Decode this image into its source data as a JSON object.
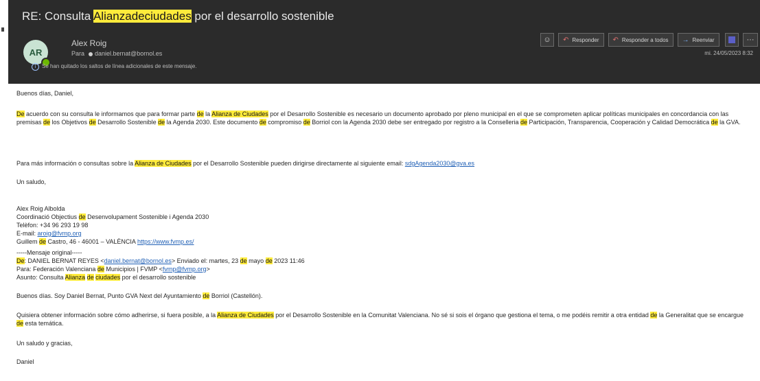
{
  "email": {
    "subject": {
      "prefix": "RE: Consulta ",
      "hl1": "Alianza",
      "hl2": "de",
      "hl3": "ciudades",
      "suffix": " por el desarrollo sostenible"
    },
    "sender": {
      "initials": "AR",
      "name": "Alex Roig",
      "to_label": "Para",
      "to_address": "daniel.bernat@bornol.es"
    },
    "info_banner": "Se han quitado los saltos de línea adicionales de este mensaje.",
    "date": "mi. 24/05/2023 8:32",
    "toolbar": {
      "reply": "Responder",
      "reply_all": "Responder a todos",
      "forward": "Reenviar",
      "more": "···"
    }
  },
  "body": {
    "greeting": "Buenos días, Daniel,",
    "p1": {
      "s1": "De",
      "t1": " acuerdo con su consulta le informamos que para formar parte ",
      "s2": "de",
      "t2": " la ",
      "s3": "Alianza de Ciudades",
      "t3": " por el Desarrollo Sostenible es necesario un documento aprobado por pleno municipal en el que se comprometen aplicar políticas municipales en concordancia con las premisas ",
      "s4": "de",
      "t4": " los Objetivos ",
      "s5": "de",
      "t5": " Desarrollo Sostenible ",
      "s6": "de",
      "t6": " la Agenda 2030. Este documento ",
      "s7": "de",
      "t7": " compromiso ",
      "s8": "de",
      "t8": " Borriol con la Agenda 2030 debe ser entregado por registro a la Conselleria ",
      "s9": "de",
      "t9": " Participación, Transparencia, Cooperación y Calidad Democrática ",
      "s10": "de",
      "t10": " la GVA."
    },
    "p2": {
      "t1": "Para más información o consultas sobre la ",
      "s1": "Alianza de Ciudades",
      "t2": " por el Desarrollo Sostenible pueden dirigirse directamente al siguiente email: ",
      "link": "sdgAgenda2030@gva.es"
    },
    "closing": "Un saludo,",
    "signature": {
      "name": "Alex Roig Albolda",
      "role_a": "Coordinació Objectius ",
      "role_de": "de",
      "role_b": " Desenvolupament Sostenible i Agenda 2030",
      "phone": "Telèfon: +34 96 293 19 98",
      "email_label": "E-mail: ",
      "email": "aroig@fvmp.org",
      "addr_a": "Guillem ",
      "addr_de": "de",
      "addr_b": " Castro, 46 - 46001 – VALÈNCIA ",
      "web": "https://www.fvmp.es/"
    },
    "original": {
      "header": "-----Mensaje original-----",
      "de_label": "De",
      "from_a": ": DANIEL BERNAT REYES <",
      "from_email": "daniel.bernat@bornol.es",
      "from_b": "> Enviado el: martes, 23 ",
      "from_de1": "de",
      "from_c": " mayo ",
      "from_de2": "de",
      "from_d": " 2023 11:46",
      "to_a": "Para: Federación Valenciana ",
      "to_de": "de",
      "to_b": " Municipios | FVMP <",
      "to_email": "fvmp@fvmp.org",
      "to_c": ">",
      "subj_a": "Asunto: Consulta ",
      "subj_s1": "Alianza",
      "subj_sp": " ",
      "subj_s2": "de",
      "subj_sp2": " ",
      "subj_s3": "ciudades",
      "subj_b": " por el desarrollo sostenible",
      "intro_a": "Buenos días. Soy Daniel Bernat, Punto GVA Next del Ayuntamiento ",
      "intro_de": "de",
      "intro_b": " Borriol (Castellón).",
      "q_a": "Quisiera obtener información sobre cómo adherirse, si fuera posible, a la ",
      "q_s1": "Alianza de Ciudades",
      "q_b": " por el Desarrollo Sostenible en la Comunitat Valenciana. No sé si sois el órgano que gestiona el tema, o me podéis remitir a otra entidad ",
      "q_de1": "de",
      "q_c": " la Generalitat que se encargue ",
      "q_de2": "de",
      "q_d": " esta temática.",
      "thanks": "Un saludo y gracias,",
      "name": "Daniel"
    }
  },
  "colors": {
    "header_bg": "#2b2b2b",
    "highlight": "#ffeb3b",
    "link": "#1f5fb5",
    "avatar_bg": "#c9e3d3",
    "presence": "#6bb700"
  }
}
